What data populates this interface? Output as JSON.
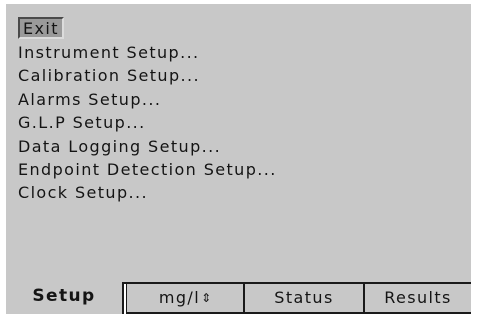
{
  "menu": {
    "exit_label": "Exit",
    "items": [
      "Instrument Setup...",
      "Calibration Setup...",
      "Alarms Setup...",
      "G.L.P Setup...",
      "Data Logging Setup...",
      "Endpoint Detection Setup...",
      "Clock Setup..."
    ]
  },
  "tabs": {
    "setup": "Setup",
    "units": "mg/l",
    "units_arrows": "⇕",
    "status": "Status",
    "results": "Results"
  }
}
